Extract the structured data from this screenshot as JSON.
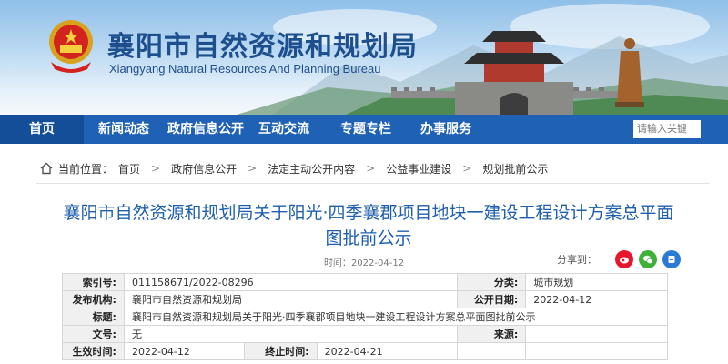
{
  "header": {
    "site_title": "襄阳市自然资源和规划局",
    "site_subtitle": "Xiangyang Natural Resources And Planning Bureau"
  },
  "nav": {
    "items": [
      {
        "label": "首页"
      },
      {
        "label": "新闻动态"
      },
      {
        "label": "政府信息公开"
      },
      {
        "label": "互动交流"
      },
      {
        "label": "专题专栏"
      },
      {
        "label": "办事服务"
      }
    ],
    "search_placeholder": "请输入关键"
  },
  "breadcrumb": {
    "prefix": "当前位置：",
    "items": [
      "首页",
      "政府信息公开",
      "法定主动公开内容",
      "公益事业建设",
      "规划批前公示"
    ]
  },
  "article": {
    "title": "襄阳市自然资源和规划局关于阳光·四季襄郡项目地块一建设工程设计方案总平面图批前公示",
    "time_label": "时间：",
    "time": "2022-04-12",
    "share_label": "分享到："
  },
  "info": {
    "index_label": "索引号:",
    "index_value": "011158671/2022-08296",
    "category_label": "分类:",
    "category_value": "城市规划",
    "publisher_label": "发布机构:",
    "publisher_value": "襄阳市自然资源和规划局",
    "pubdate_label": "公开日期:",
    "pubdate_value": "2022-04-12",
    "title_label": "标题:",
    "title_value": "襄阳市自然资源和规划局关于阳光·四季襄郡项目地块一建设工程设计方案总平面图批前公示",
    "docno_label": "文号:",
    "docno_value": "无",
    "source_label": "来源:",
    "source_value": "",
    "effective_label": "生效时间:",
    "effective_value": "2022-04-12",
    "end_label": "终止时间:",
    "end_value": "2022-04-21"
  },
  "colors": {
    "nav_bg": "#1f62b5",
    "nav_home_bg": "#144e99",
    "title_blue": "#1f5fae"
  }
}
